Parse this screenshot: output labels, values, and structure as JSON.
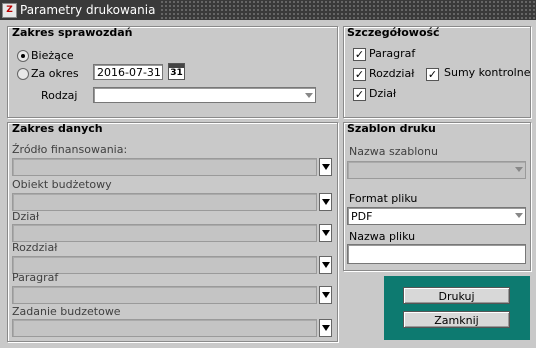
{
  "window": {
    "title": "Parametry drukowania",
    "icon": "report-icon"
  },
  "zakres_sprawozdan": {
    "title": "Zakres sprawozdań",
    "radio_biezace": "Bieżące",
    "radio_za_okres": "Za okres",
    "date_value": "2016-07-31",
    "calendar_label": "31",
    "rodzaj_label": "Rodzaj",
    "rodzaj_value": ""
  },
  "szczegolowosc": {
    "title": "Szczegółowość",
    "paragraf": "Paragraf",
    "rozdzial": "Rozdział",
    "dzial": "Dział",
    "sumy": "Sumy kontrolne",
    "check_mark": "✓"
  },
  "zakres_danych": {
    "title": "Zakres danych",
    "fields": [
      "Źródło finansowania:",
      "Obiekt budżetowy",
      "Dział",
      "Rozdział",
      "Paragraf",
      "Zadanie budzetowe"
    ]
  },
  "szablon": {
    "title": "Szablon druku",
    "nazwa_szablonu_label": "Nazwa szablonu",
    "nazwa_szablonu_value": "",
    "format_label": "Format pliku",
    "format_value": "PDF",
    "nazwa_pliku_label": "Nazwa pliku",
    "nazwa_pliku_value": ""
  },
  "buttons": {
    "drukuj": "Drukuj",
    "zamknij": "Zamknij"
  }
}
